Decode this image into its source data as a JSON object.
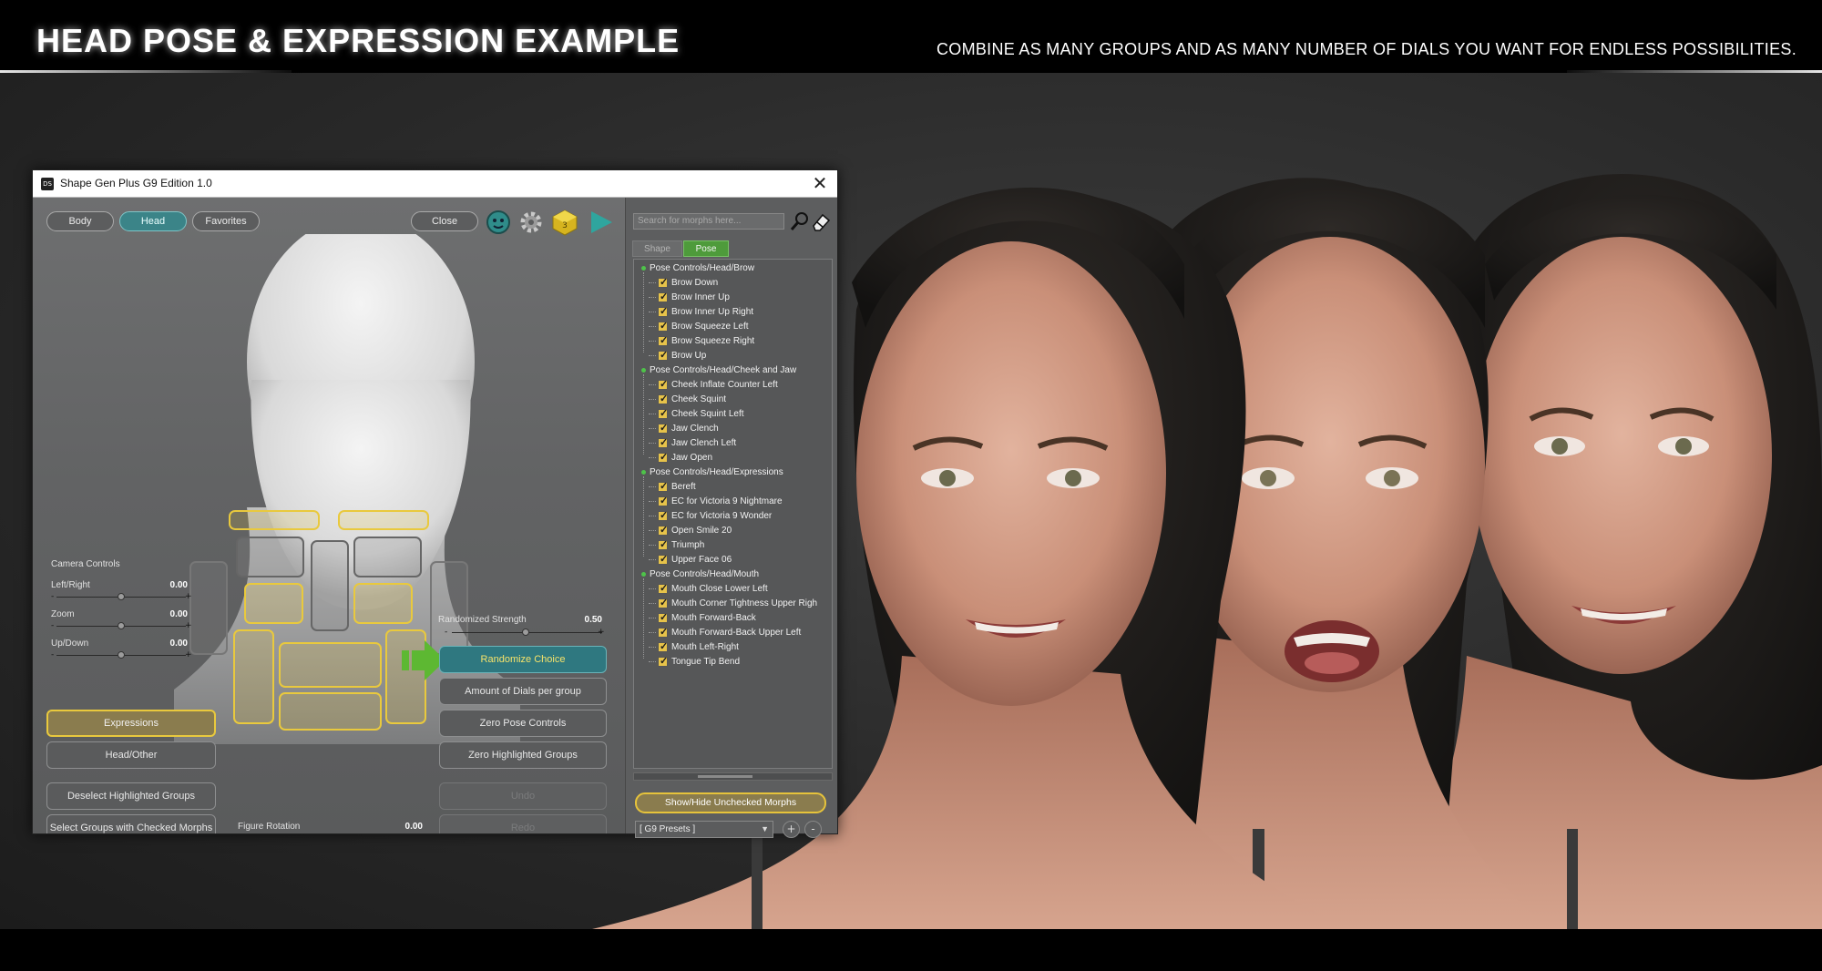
{
  "banner": {
    "title": "HEAD POSE & EXPRESSION EXAMPLE",
    "subtitle": "COMBINE AS MANY GROUPS AND AS MANY NUMBER OF DIALS YOU WANT FOR ENDLESS POSSIBILITIES."
  },
  "window": {
    "title": "Shape Gen Plus G9 Edition 1.0",
    "icon_label": "DS",
    "close_glyph": "✕"
  },
  "toolbar": {
    "tabs": [
      {
        "label": "Body",
        "active": false
      },
      {
        "label": "Head",
        "active": true
      },
      {
        "label": "Favorites",
        "active": false
      }
    ],
    "close_label": "Close",
    "icons": [
      "face-icon",
      "gear-icon",
      "daz-cube-icon",
      "play-icon"
    ]
  },
  "camera": {
    "heading": "Camera Controls",
    "sliders": [
      {
        "label": "Left/Right",
        "value": "0.00",
        "position": 0.5
      },
      {
        "label": "Zoom",
        "value": "0.00",
        "position": 0.5
      },
      {
        "label": "Up/Down",
        "value": "0.00",
        "position": 0.5
      }
    ]
  },
  "randomize": {
    "strength_label": "Randomized Strength",
    "strength_value": "0.50",
    "strength_position": 0.5,
    "choice_label": "Randomize Choice",
    "dials_label": "Amount of Dials per group",
    "zero_pose_label": "Zero Pose Controls",
    "zero_highlighted_label": "Zero Highlighted Groups",
    "undo_label": "Undo",
    "redo_label": "Redo"
  },
  "groups": {
    "expressions_label": "Expressions",
    "head_other_label": "Head/Other",
    "deselect_label": "Deselect Highlighted Groups",
    "select_checked_label": "Select Groups with Checked Morphs"
  },
  "figure_rotation": {
    "label": "Figure Rotation",
    "value": "0.00",
    "position": 0.5
  },
  "morphs": {
    "search_placeholder": "Search for morphs here...",
    "tabs": [
      {
        "label": "Shape",
        "active": false
      },
      {
        "label": "Pose",
        "active": true
      }
    ],
    "groups": [
      {
        "name": "Pose Controls/Head/Brow",
        "items": [
          "Brow Down",
          "Brow Inner Up",
          "Brow Inner Up Right",
          "Brow Squeeze Left",
          "Brow Squeeze Right",
          "Brow Up"
        ]
      },
      {
        "name": "Pose Controls/Head/Cheek and Jaw",
        "items": [
          "Cheek Inflate Counter Left",
          "Cheek Squint",
          "Cheek Squint Left",
          "Jaw Clench",
          "Jaw Clench Left",
          "Jaw Open"
        ]
      },
      {
        "name": "Pose Controls/Head/Expressions",
        "items": [
          "Bereft",
          "EC for Victoria 9 Nightmare",
          "EC for Victoria 9 Wonder",
          "Open Smile 20",
          "Triumph",
          "Upper Face 06"
        ]
      },
      {
        "name": "Pose Controls/Head/Mouth",
        "items": [
          "Mouth Close Lower Left",
          "Mouth Corner Tightness Upper Righ",
          "Mouth Forward-Back",
          "Mouth Forward-Back Upper Left",
          "Mouth Left-Right",
          "Tongue Tip Bend"
        ]
      }
    ],
    "show_hide_label": "Show/Hide Unchecked Morphs",
    "presets_label": "[ G9 Presets ]",
    "add_glyph": "+",
    "remove_glyph": "-"
  },
  "colors": {
    "accent_teal": "#3b8488",
    "highlight_gold": "#e9c93d",
    "pose_tab_green": "#4e9b3b",
    "arrow_green": "#5db832"
  }
}
